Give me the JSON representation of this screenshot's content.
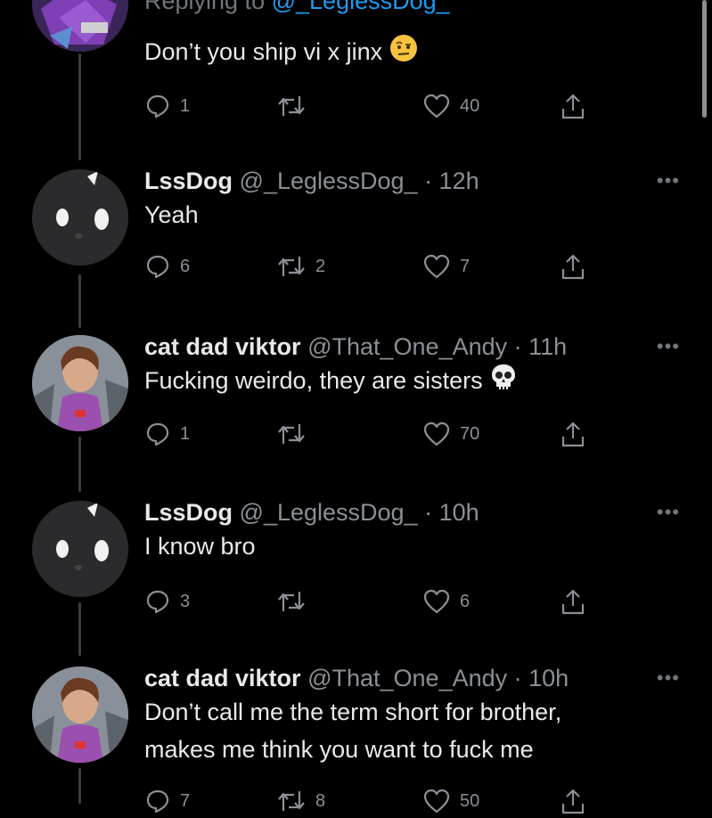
{
  "colors": {
    "background": "#000000",
    "text": "#e7e9ea",
    "muted": "#8b9096",
    "link": "#1d9bf0"
  },
  "first_tweet": {
    "replying_prefix": "Replying to",
    "replying_handle": "@_LeglessDog_",
    "text": "Don’t you ship vi x jinx",
    "emoji": "face-with-raised-eyebrow",
    "replies": "1",
    "retweets": "",
    "likes": "40"
  },
  "tweets": [
    {
      "name": "LssDog",
      "handle": "@_LeglessDog_",
      "time": "· 12h",
      "text": "Yeah",
      "replies": "6",
      "retweets": "2",
      "likes": "7"
    },
    {
      "name": "cat dad viktor",
      "handle": "@That_One_Andy",
      "time": "· 11h",
      "text": "Fucking weirdo, they are sisters",
      "emoji": "skull",
      "replies": "1",
      "retweets": "",
      "likes": "70"
    },
    {
      "name": "LssDog",
      "handle": "@_LeglessDog_",
      "time": "· 10h",
      "text": "I know bro",
      "replies": "3",
      "retweets": "",
      "likes": "6"
    },
    {
      "name": "cat dad viktor",
      "handle": "@That_One_Andy",
      "time": "· 10h",
      "text_line1": "Don’t call me the term short for brother,",
      "text_line2": "makes me think you want to fuck me",
      "replies": "7",
      "retweets": "8",
      "likes": "50"
    }
  ],
  "more_label": "•••"
}
